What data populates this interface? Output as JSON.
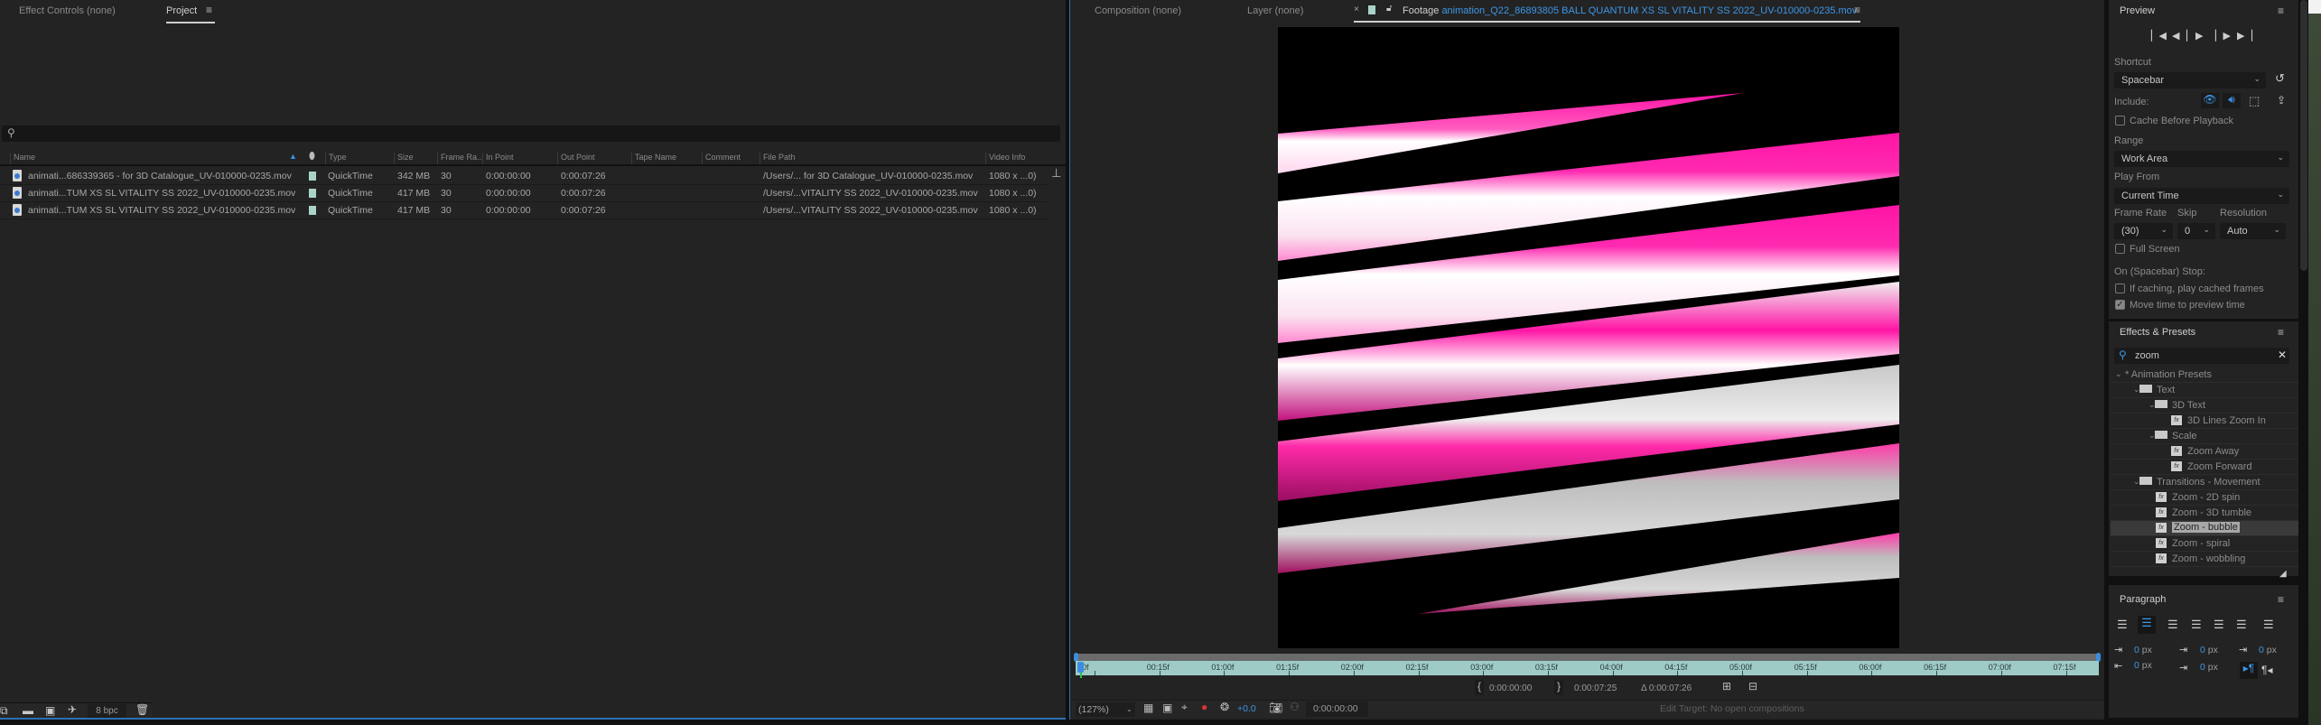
{
  "project_panel": {
    "tabs": [
      {
        "label": "Effect Controls (none)",
        "active": false
      },
      {
        "label": "Project",
        "active": true
      }
    ],
    "menu_icon": "hamburger-icon",
    "search": {
      "value": "",
      "placeholder": "",
      "icon": "search-icon"
    },
    "columns": [
      "Name",
      "Type",
      "Size",
      "Frame Ra...",
      "In Point",
      "Out Point",
      "Tape Name",
      "Comment",
      "File Path",
      "Video Info"
    ],
    "sort_column": "Name",
    "rows": [
      {
        "name": "animati...686339365 - for 3D Catalogue_UV-010000-0235.mov",
        "type": "QuickTime",
        "size": "342 MB",
        "frame_rate": "30",
        "in_point": "0:00:00:00",
        "out_point": "0:00:07:26",
        "tape_name": "",
        "comment": "",
        "file_path": "/Users/... for 3D Catalogue_UV-010000-0235.mov",
        "video_info": "1080 x ...0)"
      },
      {
        "name": "animati...TUM XS SL VITALITY SS 2022_UV-010000-0235.mov",
        "type": "QuickTime",
        "size": "417 MB",
        "frame_rate": "30",
        "in_point": "0:00:00:00",
        "out_point": "0:00:07:26",
        "tape_name": "",
        "comment": "",
        "file_path": "/Users/...VITALITY SS 2022_UV-010000-0235.mov",
        "video_info": "1080 x ...0)"
      },
      {
        "name": "animati...TUM XS SL VITALITY SS 2022_UV-010000-0235.mov",
        "type": "QuickTime",
        "size": "417 MB",
        "frame_rate": "30",
        "in_point": "0:00:00:00",
        "out_point": "0:00:07:26",
        "tape_name": "",
        "comment": "",
        "file_path": "/Users/...VITALITY SS 2022_UV-010000-0235.mov",
        "video_info": "1080 x ...0)"
      }
    ],
    "label_color": "#a9d3c9",
    "footer": {
      "bpc": "8 bpc"
    }
  },
  "viewer": {
    "tabs": [
      {
        "label": "Composition (none)",
        "active": false
      },
      {
        "label": "Layer (none)",
        "active": false
      },
      {
        "prefix": "Footage",
        "label": "animation_Q22_86893805 BALL QUANTUM XS SL VITALITY SS 2022_UV-010000-0235.mov",
        "active": true
      }
    ],
    "ruler_ticks": [
      "0f",
      "00:15f",
      "01:00f",
      "01:15f",
      "02:00f",
      "02:15f",
      "03:00f",
      "03:15f",
      "04:00f",
      "04:15f",
      "05:00f",
      "05:15f",
      "06:00f",
      "06:15f",
      "07:00f",
      "07:15f"
    ],
    "in_point": "0:00:00:00",
    "out_point": "0:00:07:25",
    "duration": "Δ 0:00:07:26",
    "zoom": "(127%)",
    "exposure": "+0.0",
    "current_time": "0:00:00:00",
    "edit_target": "Edit Target: No open compositions",
    "footage_colors": {
      "magenta": "#ff14a5",
      "white": "#ffffff",
      "gray": "#bdbdbd"
    }
  },
  "preview": {
    "title": "Preview",
    "shortcut_label": "Shortcut",
    "shortcut_value": "Spacebar",
    "include_label": "Include:",
    "cache_before_playback": {
      "label": "Cache Before Playback",
      "checked": false
    },
    "range_label": "Range",
    "range_value": "Work Area",
    "play_from_label": "Play From",
    "play_from_value": "Current Time",
    "frame_rate_label": "Frame Rate",
    "frame_rate_value": "(30)",
    "skip_label": "Skip",
    "skip_value": "0",
    "resolution_label": "Resolution",
    "resolution_value": "Auto",
    "full_screen": {
      "label": "Full Screen",
      "checked": false
    },
    "stop_label": "On (Spacebar) Stop:",
    "if_caching": {
      "label": "If caching, play cached frames",
      "checked": false
    },
    "move_time": {
      "label": "Move time to preview time",
      "checked": true
    },
    "accent": "#2d8ceb"
  },
  "effects": {
    "title": "Effects & Presets",
    "search_value": "zoom",
    "tree": [
      {
        "label": "* Animation Presets",
        "kind": "root"
      },
      {
        "label": "Text",
        "kind": "folder"
      },
      {
        "label": "3D Text",
        "kind": "folder"
      },
      {
        "label": "3D Lines Zoom In",
        "kind": "preset"
      },
      {
        "label": "Scale",
        "kind": "folder"
      },
      {
        "label": "Zoom Away",
        "kind": "preset"
      },
      {
        "label": "Zoom Forward",
        "kind": "preset"
      },
      {
        "label": "Transitions - Movement",
        "kind": "folder"
      },
      {
        "label": "Zoom - 2D spin",
        "kind": "preset"
      },
      {
        "label": "Zoom - 3D tumble",
        "kind": "preset"
      },
      {
        "label": "Zoom - bubble",
        "kind": "preset",
        "selected": true
      },
      {
        "label": "Zoom - spiral",
        "kind": "preset"
      },
      {
        "label": "Zoom - wobbling",
        "kind": "preset"
      }
    ]
  },
  "paragraph": {
    "title": "Paragraph",
    "indent_left": "0",
    "space_before": "0",
    "indent_first": "0",
    "indent_right": "0",
    "space_after": "0",
    "unit": "px"
  }
}
